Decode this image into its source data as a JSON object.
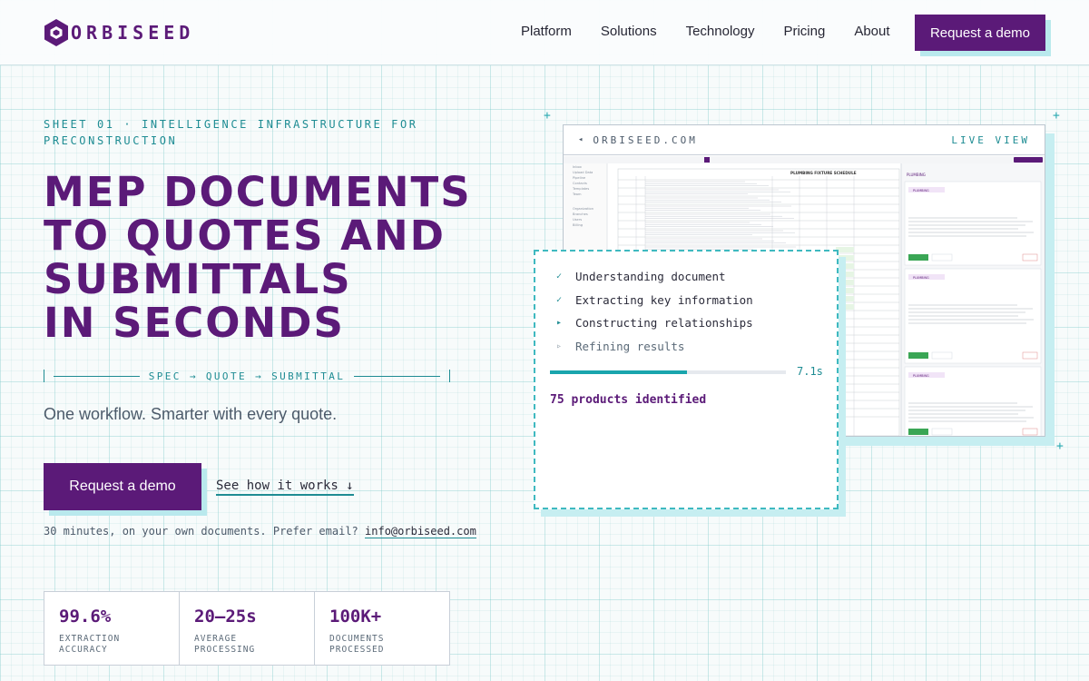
{
  "header": {
    "brand": "ORBISEED",
    "nav": [
      "Platform",
      "Solutions",
      "Technology",
      "Pricing",
      "About"
    ],
    "cta": "Request a demo"
  },
  "hero": {
    "eyebrow": "SHEET 01 · INTELLIGENCE INFRASTRUCTURE FOR PRECONSTRUCTION",
    "headline": [
      "MEP DOCUMENTS",
      "TO QUOTES AND",
      "SUBMITTALS",
      "IN SECONDS"
    ],
    "flow": "SPEC → QUOTE → SUBMITTAL",
    "subhead": "One workflow. Smarter with every quote.",
    "cta": "Request a demo",
    "secondary": "See how it works ↓",
    "note": "30 minutes, on your own documents. Prefer email?",
    "email": "info@orbiseed.com"
  },
  "stats": [
    {
      "value": "99.6%",
      "label": "EXTRACTION ACCURACY"
    },
    {
      "value": "20–25s",
      "label": "AVERAGE PROCESSING"
    },
    {
      "value": "100K+",
      "label": "DOCUMENTS PROCESSED"
    }
  ],
  "preview": {
    "url": "ORBISEED.COM",
    "badge": "LIVE VIEW",
    "schedule_title": "PLUMBING FIXTURE SCHEDULE",
    "sidebar": [
      "Inbox",
      "Upload Data",
      "Pipeline",
      "Contacts",
      "Templates",
      "Team",
      "Organization",
      "Branches",
      "Users",
      "Billing"
    ],
    "panel_title": "PLUMBING",
    "panel_badge": "PLUMBING"
  },
  "progress": {
    "steps": [
      {
        "label": "Understanding document",
        "state": "done"
      },
      {
        "label": "Extracting key information",
        "state": "done"
      },
      {
        "label": "Constructing relationships",
        "state": "active"
      },
      {
        "label": "Refining results",
        "state": "pending"
      }
    ],
    "fraction": 0.58,
    "time": "7.1s",
    "result": "75 products identified"
  },
  "colors": {
    "brand": "#5b1a78",
    "accent": "#1e8c93",
    "accent_light": "#c6eef1"
  }
}
